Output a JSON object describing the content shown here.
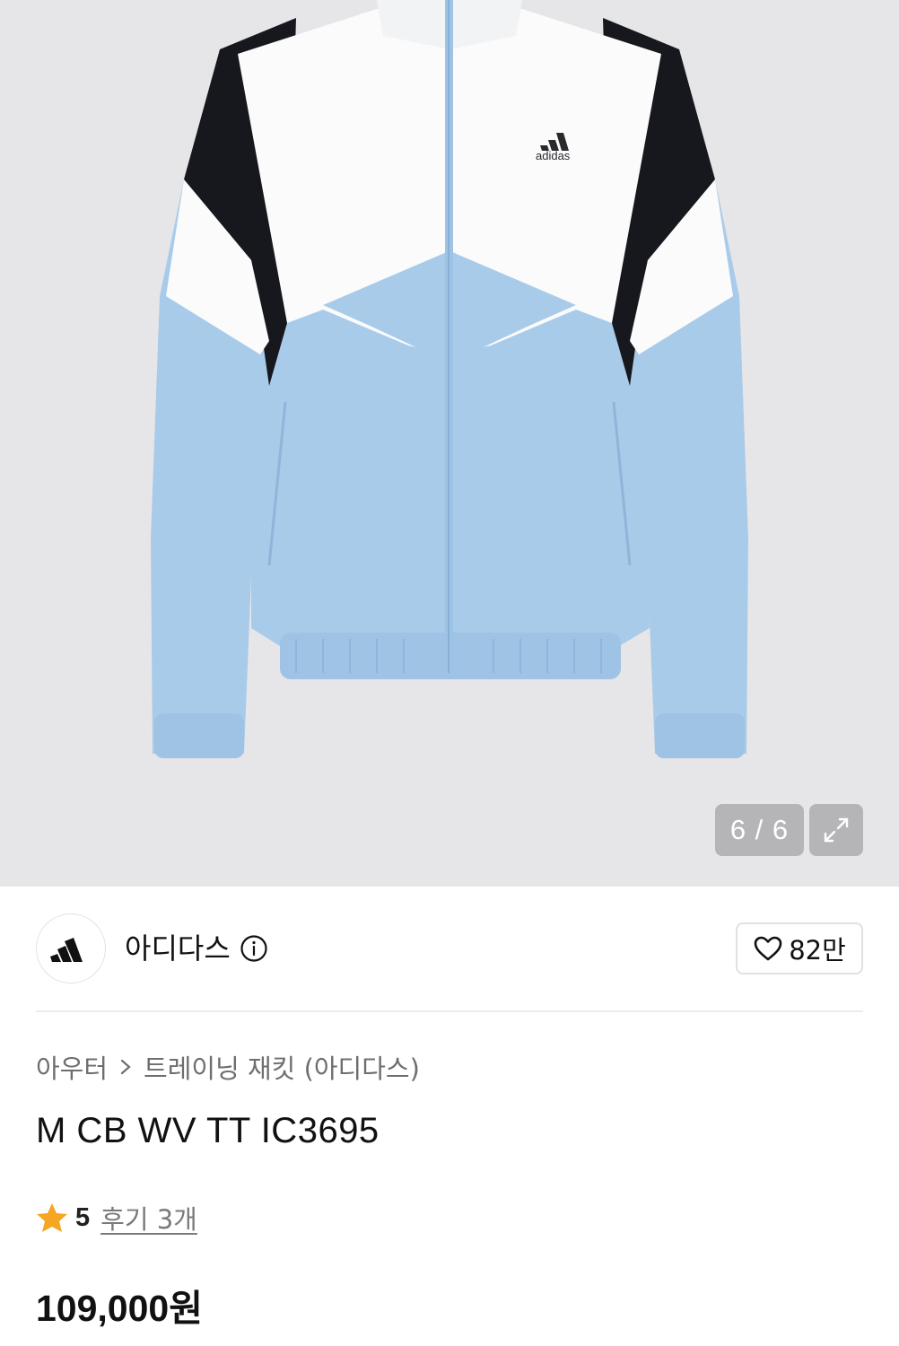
{
  "gallery": {
    "counter": "6 / 6",
    "expand_icon": "expand-icon",
    "jacket_logo": "adidas"
  },
  "brand": {
    "name": "아디다스",
    "logo_icon": "adidas-logo-icon",
    "info_icon": "info-icon"
  },
  "like": {
    "count": "82만",
    "icon": "heart-icon"
  },
  "breadcrumb": {
    "category": "아우터",
    "subcategory": "트레이닝 재킷 (아디다스)",
    "separator_icon": "chevron-right-icon"
  },
  "product": {
    "title": "M CB WV TT IC3695",
    "rating": "5",
    "reviews": "후기 3개",
    "price": "109,000원"
  },
  "colors": {
    "star": "#f5a623",
    "jacket_blue": "#a9cbea",
    "jacket_black": "#16181d"
  }
}
